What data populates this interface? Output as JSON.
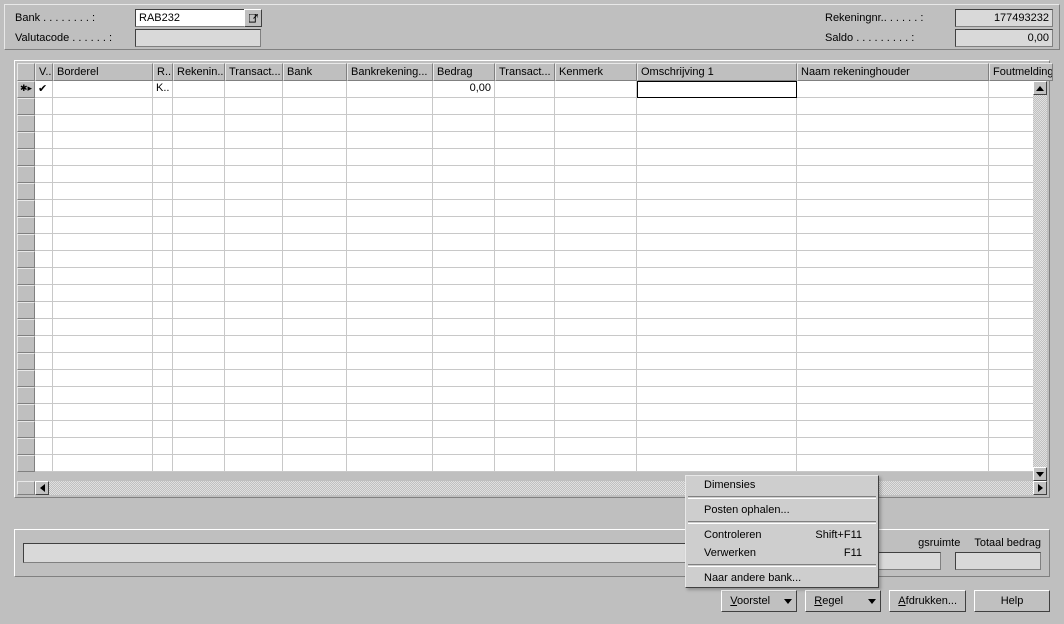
{
  "header": {
    "bank_label": "Bank . . . . . . . . :",
    "bank_value": "RAB232",
    "valuta_label": "Valutacode . . . . . . :",
    "valuta_value": "",
    "rekening_label": "Rekeningnr.. . . . . . :",
    "rekening_value": "177493232",
    "saldo_label": "Saldo . . . . . . . . . :",
    "saldo_value": "0,00"
  },
  "columns": {
    "c0": "V..",
    "c1": "Borderel",
    "c2": "R..",
    "c3": "Rekenin...",
    "c4": "Transact...",
    "c5": "Bank",
    "c6": "Bankrekening...",
    "c7": "Bedrag",
    "c8": "Transact...",
    "c9": "Kenmerk",
    "c10": "Omschrijving 1",
    "c11": "Naam rekeninghouder",
    "c12": "Foutmelding"
  },
  "row0": {
    "marker": "✱▸",
    "v": "✔",
    "r": "K..",
    "bedrag": "0,00",
    "omschrijving": ""
  },
  "memo": {
    "gsruimte_label": "gsruimte",
    "totaal_label": "Totaal bedrag"
  },
  "buttons": {
    "voorstel": "Voorstel",
    "regel": "Regel",
    "afdrukken": "Afdrukken...",
    "help": "Help"
  },
  "menu": {
    "dimensies": "Dimensies",
    "posten": "Posten ophalen...",
    "controleren": "Controleren",
    "controleren_hk": "Shift+F11",
    "verwerken": "Verwerken",
    "verwerken_hk": "F11",
    "naarbank": "Naar andere bank..."
  }
}
